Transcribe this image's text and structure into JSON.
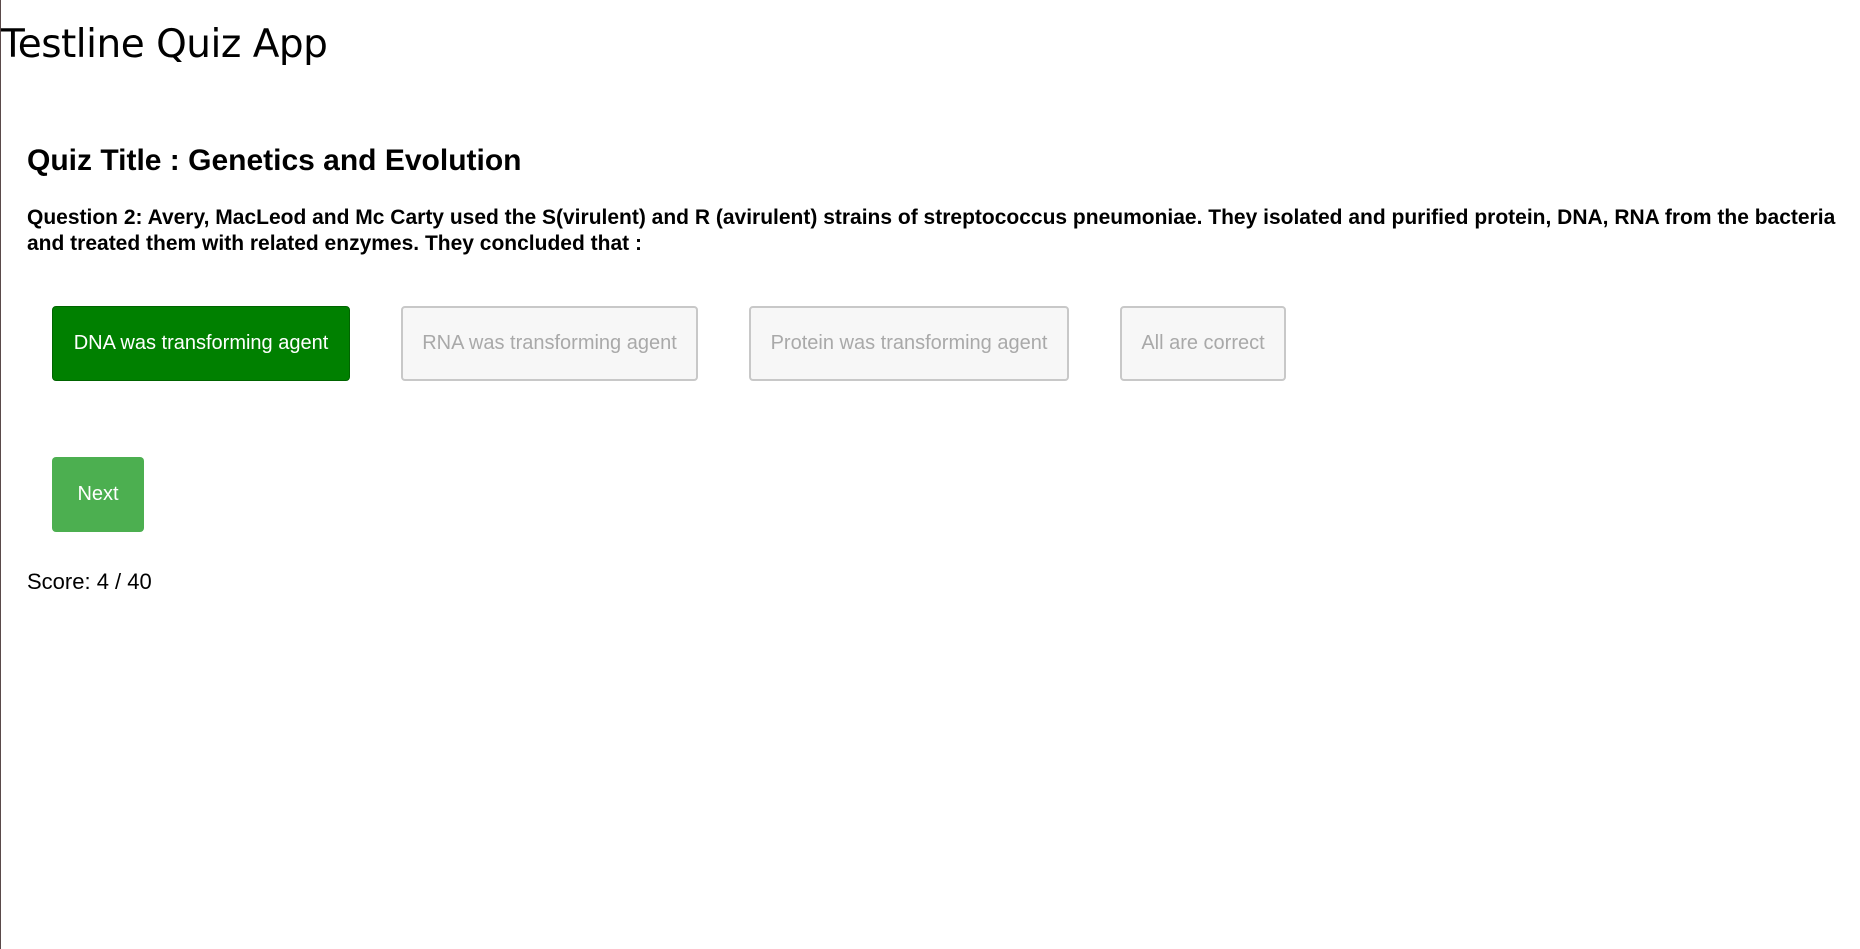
{
  "app": {
    "title": "Testline Quiz App"
  },
  "quiz": {
    "title": "Quiz Title : Genetics and Evolution",
    "question": "Question 2: Avery, MacLeod and Mc Carty used the S(virulent) and R (avirulent) strains of streptococcus pneumoniae. They isolated and purified protein, DNA, RNA from the bacteria and treated them with related enzymes. They concluded that :",
    "options": [
      {
        "label": "DNA was transforming agent",
        "state": "selected"
      },
      {
        "label": "RNA was transforming agent",
        "state": "disabled"
      },
      {
        "label": "Protein was transforming agent",
        "state": "disabled"
      },
      {
        "label": "All are correct",
        "state": "disabled"
      }
    ],
    "next_label": "Next",
    "score_text": "Score: 4 / 40"
  },
  "colors": {
    "selected": "#008000",
    "next": "#4caf50",
    "disabled_text": "#a9a9a9"
  }
}
